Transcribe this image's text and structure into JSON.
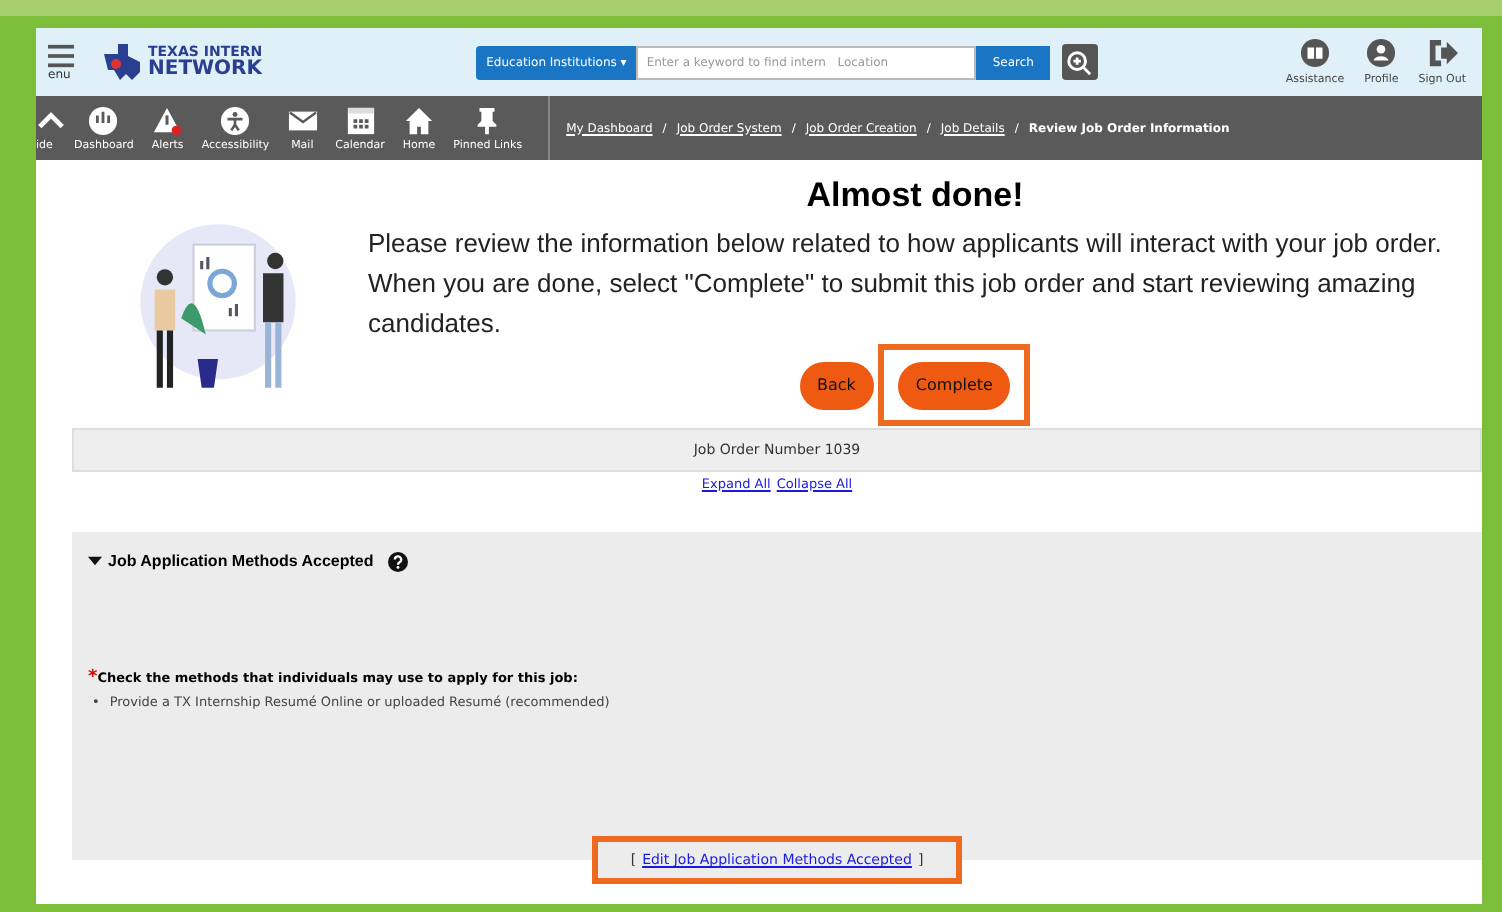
{
  "header": {
    "menu_label": "enu",
    "logo": {
      "line1": "TEXAS INTERN",
      "line2": "NETWORK"
    },
    "search": {
      "dropdown": "Education Institutions",
      "dropdown_caret": "▾",
      "placeholder": "Enter a keyword to find intern   Location",
      "button": "Search"
    },
    "actions": [
      {
        "kind": "book",
        "label": "Assistance"
      },
      {
        "kind": "person",
        "label": "Profile"
      },
      {
        "kind": "exit",
        "label": "Sign Out"
      }
    ]
  },
  "toolbar": {
    "items": [
      {
        "kind": "chevron",
        "label": "ide"
      },
      {
        "kind": "dashboard",
        "label": "Dashboard"
      },
      {
        "kind": "alert",
        "label": "Alerts"
      },
      {
        "kind": "access",
        "label": "Accessibility"
      },
      {
        "kind": "mail",
        "label": "Mail"
      },
      {
        "kind": "calendar",
        "label": "Calendar"
      },
      {
        "kind": "home",
        "label": "Home"
      },
      {
        "kind": "pin",
        "label": "Pinned Links"
      }
    ],
    "breadcrumb_separator": "/",
    "breadcrumbs": [
      {
        "label": "My Dashboard",
        "current": false
      },
      {
        "label": "Job Order System",
        "current": false
      },
      {
        "label": "Job Order Creation",
        "current": false
      },
      {
        "label": "Job Details",
        "current": false
      },
      {
        "label": "Review Job Order Information",
        "current": true
      }
    ]
  },
  "intro": {
    "title": "Almost done!",
    "text": "Please review the information below related to how applicants will interact with your job order. When you are done, select \"Complete\" to submit this job order and start reviewing amazing candidates.",
    "buttons": [
      {
        "label": "Back",
        "highlighted": false
      },
      {
        "label": "Complete",
        "highlighted": true
      }
    ]
  },
  "job_order_number": "Job Order Number 1039",
  "expand_links": [
    "Expand All",
    "Collapse All"
  ],
  "section": {
    "title": "Job Application Methods Accepted",
    "expanded": true,
    "required_mark": "*",
    "prompt": "Check the methods that individuals may use to apply for this job:",
    "items": [
      {
        "bullet": "•",
        "text": "Provide a TX Internship Resumé Online or uploaded Resumé (recommended)"
      }
    ],
    "edit_link": {
      "open": "[",
      "label": "Edit Job Application Methods Accepted",
      "close": "]",
      "highlighted": true
    }
  }
}
